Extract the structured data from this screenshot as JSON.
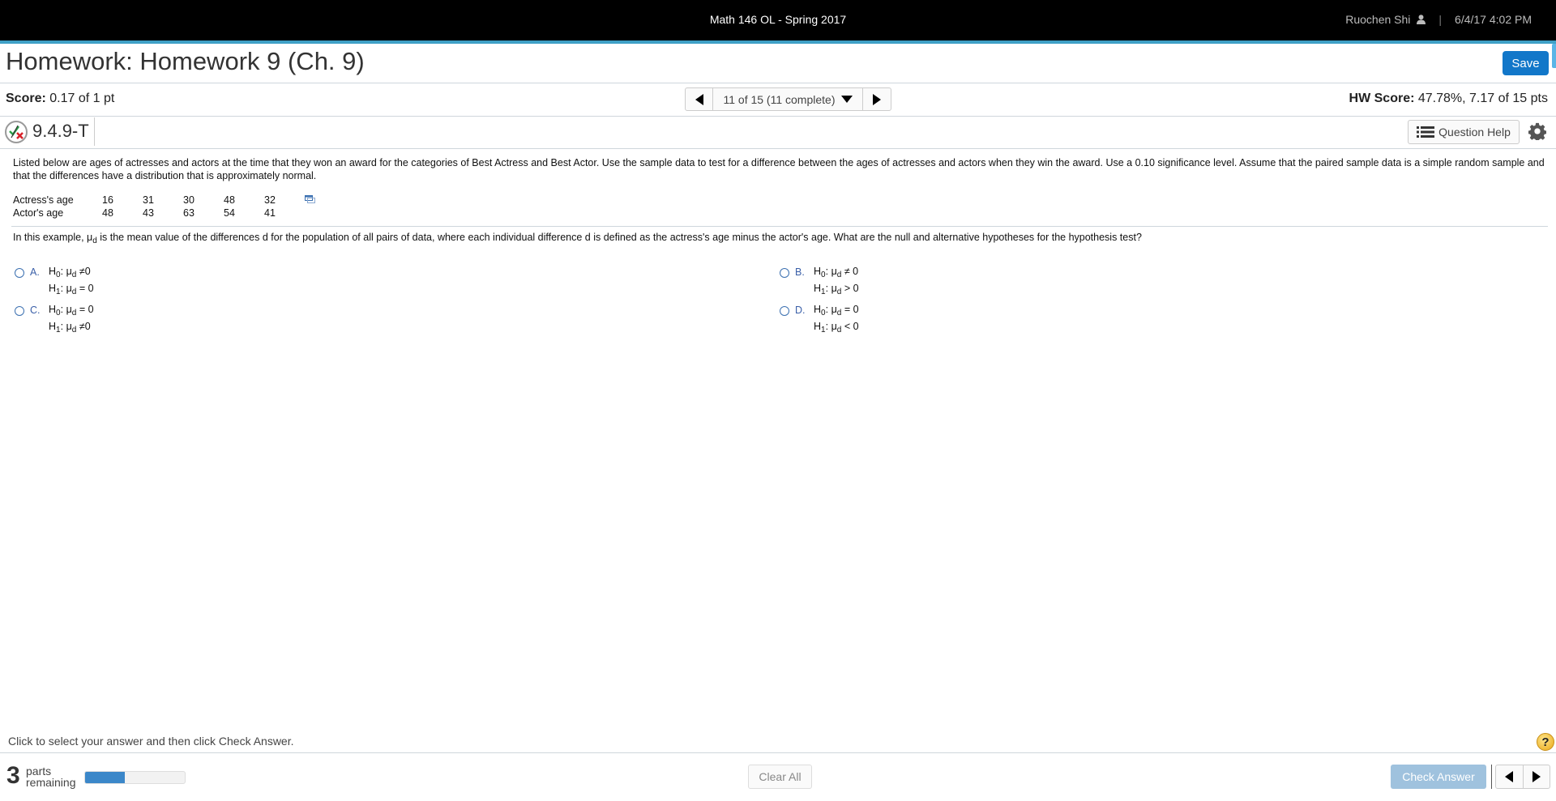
{
  "topbar": {
    "course": "Math 146 OL - Spring 2017",
    "user": "Ruochen Shi",
    "separator": "|",
    "datetime": "6/4/17 4:02 PM"
  },
  "header": {
    "title": "Homework: Homework 9 (Ch. 9)",
    "save_label": "Save"
  },
  "score_bar": {
    "score_label": "Score:",
    "score_value": "0.17 of 1 pt",
    "nav_position": "11 of 15 (11 complete)",
    "hw_score_label": "HW Score:",
    "hw_score_value": "47.78%, 7.17 of 15 pts"
  },
  "question": {
    "id": "9.4.9-T",
    "help_label": "Question Help",
    "prompt": "Listed below are ages of actresses and actors at the time that they won an award for the categories of Best Actress and Best Actor. Use the sample data to test for a difference between the ages of actresses and actors when they win the award. Use a 0.10 significance level. Assume that the paired sample data is a simple random sample and that the differences have a distribution that is approximately normal.",
    "table": {
      "rows": [
        {
          "label": "Actress's age",
          "values": [
            "16",
            "31",
            "30",
            "48",
            "32"
          ]
        },
        {
          "label": "Actor's age",
          "values": [
            "48",
            "43",
            "63",
            "54",
            "41"
          ]
        }
      ]
    },
    "text_before": "In this example, ",
    "mu": "μ",
    "sub_d": "d",
    "text_after": " is the mean value of the differences d for the population of all pairs of data, where each individual difference d is defined as the actress's age minus the actor's age. What are the null and alternative hypotheses for the hypothesis test?",
    "options": [
      {
        "letter": "A.",
        "h0_op": "≠",
        "h1_op": "="
      },
      {
        "letter": "B.",
        "h0_op": "≠",
        "h1_op": ">"
      },
      {
        "letter": "C.",
        "h0_op": "=",
        "h1_op": "≠"
      },
      {
        "letter": "D.",
        "h0_op": "=",
        "h1_op": "<"
      }
    ],
    "hyp": {
      "H": "H",
      "zero": "0",
      "one": "1",
      "colon": ":",
      "value": "0"
    }
  },
  "footer": {
    "hint": "Click to select your answer and then click Check Answer.",
    "help_symbol": "?",
    "parts_count": "3",
    "parts_label_1": "parts",
    "parts_label_2": "remaining",
    "progress_fraction": 0.4,
    "clear_label": "Clear All",
    "check_label": "Check Answer"
  },
  "colors": {
    "accent_line": "#3fa0c6",
    "save_button": "#1277c9",
    "check_button_disabled": "#9fc2de",
    "progress_fill": "#3b87c9",
    "option_letter": "#3a5fa8"
  }
}
